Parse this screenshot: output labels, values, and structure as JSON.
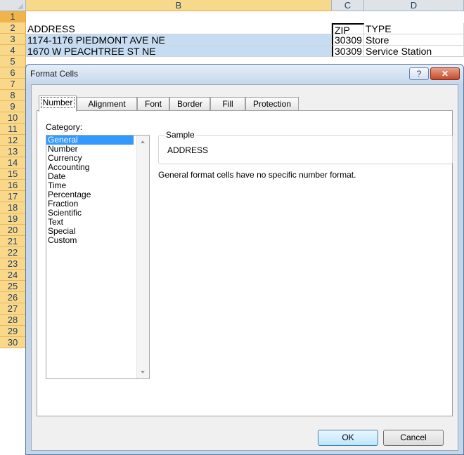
{
  "sheet": {
    "columns": [
      "B",
      "C",
      "D"
    ],
    "rows": [
      "1",
      "2",
      "3",
      "4",
      "5",
      "6",
      "7",
      "8",
      "9",
      "10",
      "11",
      "12",
      "13",
      "14",
      "15",
      "16",
      "17",
      "18",
      "19",
      "20",
      "21",
      "22",
      "23",
      "24",
      "25",
      "26",
      "27",
      "28",
      "29",
      "30"
    ],
    "cells": {
      "r1": {
        "b": "ADDRESS",
        "c": "ZIP",
        "d": "TYPE"
      },
      "r2": {
        "b": "1174-1176 PIEDMONT AVE NE",
        "c": "30309",
        "d": "Store"
      },
      "r3": {
        "b": "1670 W PEACHTREE ST NE",
        "c": "30309",
        "d": "Service Station"
      }
    },
    "selection_color": "#c5dcf2",
    "row_header_color": "#f9d88a"
  },
  "dialog": {
    "title": "Format Cells",
    "help_label": "?",
    "close_label": "✕",
    "tabs": [
      "Number",
      "Alignment",
      "Font",
      "Border",
      "Fill",
      "Protection"
    ],
    "active_tab": "Number",
    "category_label": "Category:",
    "categories": [
      "General",
      "Number",
      "Currency",
      "Accounting",
      "Date",
      "Time",
      "Percentage",
      "Fraction",
      "Scientific",
      "Text",
      "Special",
      "Custom"
    ],
    "selected_category": "General",
    "sample_label": "Sample",
    "sample_value": "ADDRESS",
    "description": "General format cells have no specific number format.",
    "ok_label": "OK",
    "cancel_label": "Cancel"
  }
}
